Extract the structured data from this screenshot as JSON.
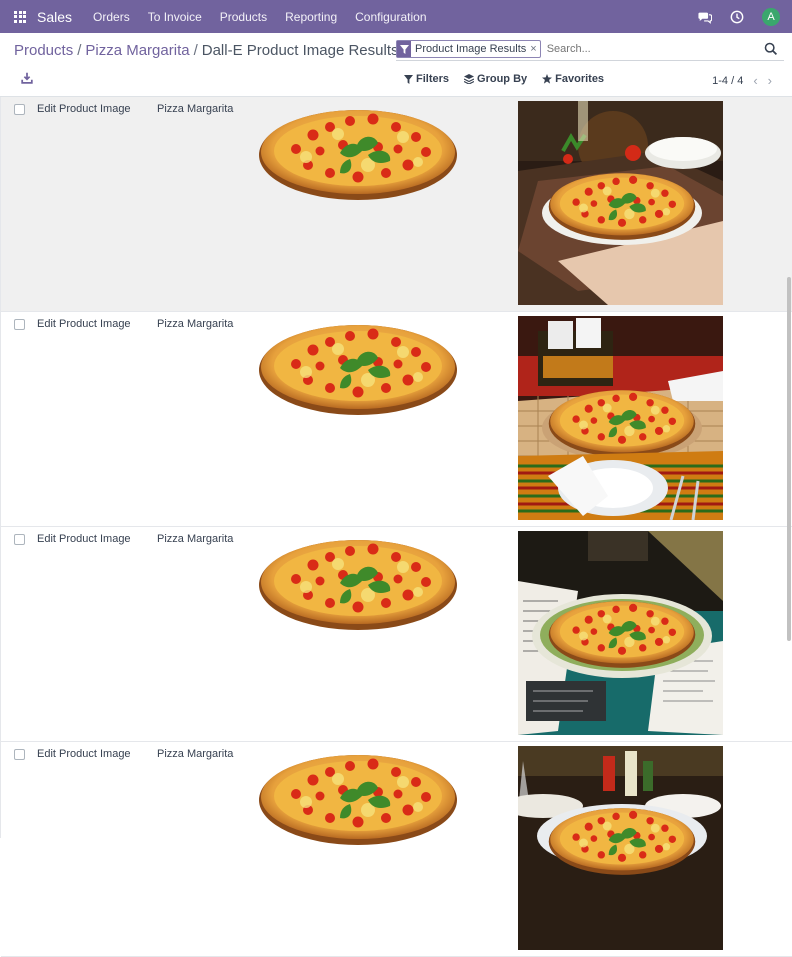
{
  "nav": {
    "brand": "Sales",
    "menu": [
      "Orders",
      "To Invoice",
      "Products",
      "Reporting",
      "Configuration"
    ],
    "avatar_initial": "A"
  },
  "breadcrumb": {
    "items": [
      "Products",
      "Pizza Margarita"
    ],
    "separator": "/",
    "current": "Dall-E Product Image Results"
  },
  "search": {
    "facet_label": "Product Image Results",
    "facet_close": "×",
    "placeholder": "Search..."
  },
  "toolbar": {
    "filters_label": "Filters",
    "group_by_label": "Group By",
    "favorites_label": "Favorites"
  },
  "pager": {
    "value": "1-4 / 4",
    "prev": "‹",
    "next": "›"
  },
  "rows": [
    {
      "name": "Edit Product Image",
      "product": "Pizza Margarita",
      "scene": "wood-table"
    },
    {
      "name": "Edit Product Image",
      "product": "Pizza Margarita",
      "scene": "restaurant-red"
    },
    {
      "name": "Edit Product Image",
      "product": "Pizza Margarita",
      "scene": "menu-table"
    },
    {
      "name": "Edit Product Image",
      "product": "Pizza Margarita",
      "scene": "bar-dinner"
    }
  ],
  "colors": {
    "navbar": "#71639e",
    "accent": "#71639e",
    "avatar": "#3aa76d"
  }
}
